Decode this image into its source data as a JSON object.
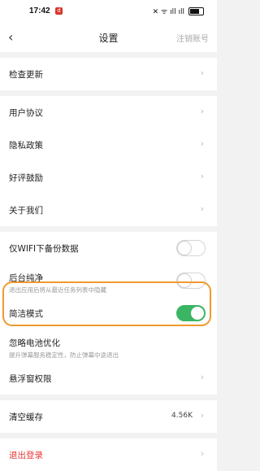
{
  "status_bar": {
    "time": "17:42",
    "icons_text": "✕ ᯤ ıll ıll"
  },
  "header": {
    "back_icon": "back-arrow-icon",
    "title": "设置",
    "action": "注销账号"
  },
  "groups": [
    {
      "items": [
        {
          "label": "检查更新"
        }
      ]
    },
    {
      "items": [
        {
          "label": "用户协议"
        },
        {
          "label": "隐私政策"
        },
        {
          "label": "好评鼓励"
        },
        {
          "label": "关于我们"
        }
      ]
    },
    {
      "items": [
        {
          "label": "仅WIFI下备份数据",
          "toggle": false
        },
        {
          "label": "后台纯净",
          "sub": "退出应用后将从最近任务列表中隐藏",
          "toggle": false
        },
        {
          "label": "简洁模式",
          "toggle": true
        },
        {
          "label": "忽略电池优化",
          "sub": "提升弹幕服务稳定性，防止弹幕中途退出"
        },
        {
          "label": "悬浮窗权限"
        }
      ]
    },
    {
      "items": [
        {
          "label": "清空缓存",
          "value": "4.56K"
        }
      ]
    },
    {
      "items": [
        {
          "label": "退出登录"
        }
      ]
    }
  ],
  "colors": {
    "toggle_on": "#3bb564",
    "highlight_border": "#ef9a2e",
    "danger": "#e53935"
  }
}
